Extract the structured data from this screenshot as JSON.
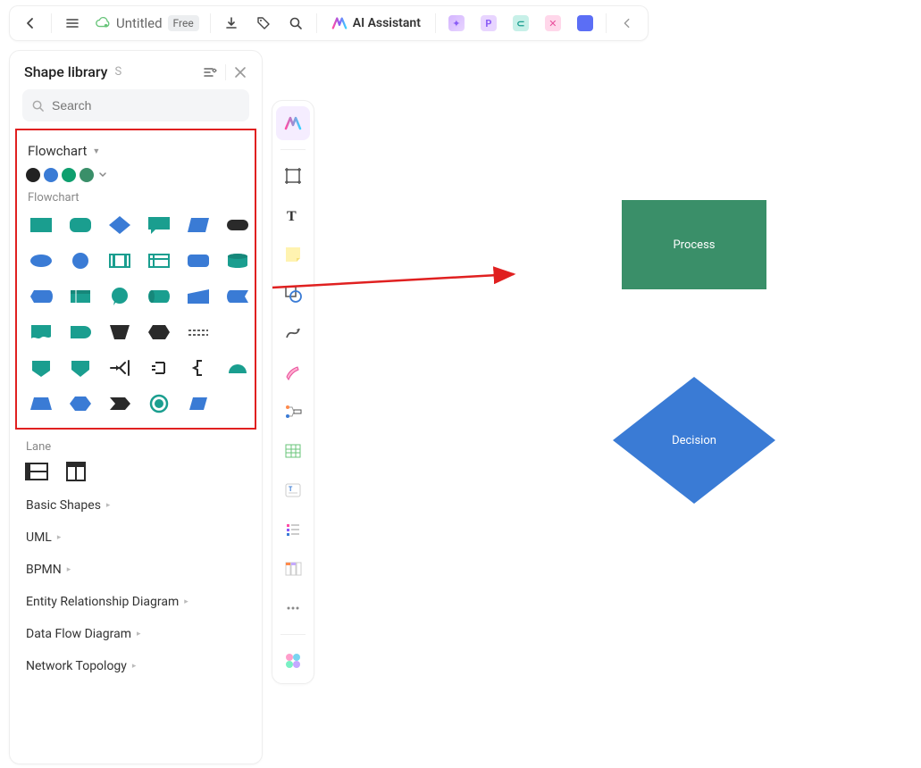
{
  "header": {
    "doc_title": "Untitled",
    "badge": "Free",
    "ai_label": "AI Assistant"
  },
  "panel": {
    "title": "Shape library",
    "shortcut": "S",
    "search_placeholder": "Search",
    "section_title": "Flowchart",
    "sub_label": "Flowchart",
    "lane_label": "Lane",
    "color_palette": [
      "#222222",
      "#3a7bd5",
      "#0e9f6e",
      "#3a8f69"
    ],
    "shapes_row1": [
      "process",
      "rounded",
      "decision",
      "callout",
      "parallelogram",
      "terminator"
    ],
    "shapes_row2": [
      "ellipse",
      "circle",
      "barcode-v",
      "barcode-h",
      "alt-process",
      "database"
    ],
    "shapes_row3": [
      "display-left",
      "table",
      "comment",
      "cylinder-side",
      "manual",
      "storage"
    ],
    "shapes_row4": [
      "flag",
      "arrow-right",
      "trapezoid-dark",
      "hexagon-dark",
      "dashed-line"
    ],
    "shapes_row5": [
      "pentagon",
      "shield",
      "merge",
      "summing",
      "bracket-left",
      "semi-circle"
    ],
    "shapes_row6": [
      "trapezoid",
      "hex",
      "tag-dark",
      "circle-ring",
      "skew"
    ],
    "categories": [
      "Basic Shapes",
      "UML",
      "BPMN",
      "Entity Relationship Diagram",
      "Data Flow Diagram",
      "Network Topology"
    ]
  },
  "canvas": {
    "process_label": "Process",
    "decision_label": "Decision"
  },
  "colors": {
    "teal": "#1a9e8f",
    "blue": "#3a7bd5",
    "dark": "#2a2a2a",
    "green": "#3a8f69"
  }
}
